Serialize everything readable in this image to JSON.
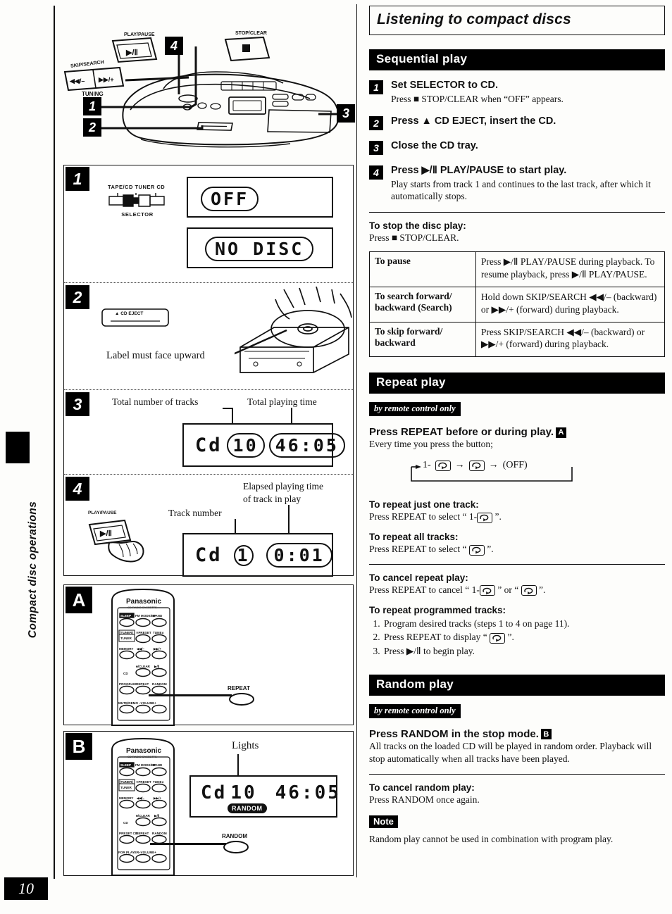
{
  "page": {
    "number": "10",
    "side_tab": "Compact disc operations"
  },
  "header": {
    "title": "Listening to compact discs"
  },
  "sections": {
    "sequential": {
      "heading": "Sequential play",
      "steps": [
        {
          "num": "1",
          "title": "Set SELECTOR to CD.",
          "detail": "Press ■ STOP/CLEAR when “OFF” appears."
        },
        {
          "num": "2",
          "title": "Press ▲ CD EJECT, insert the CD.",
          "detail": ""
        },
        {
          "num": "3",
          "title": "Close the CD tray.",
          "detail": ""
        },
        {
          "num": "4",
          "title": "Press ▶/Ⅱ PLAY/PAUSE to start play.",
          "detail": "Play starts from track 1 and continues to the last track, after which it automatically stops."
        }
      ],
      "stop_heading": "To stop the disc play:",
      "stop_text": "Press ■ STOP/CLEAR.",
      "table": {
        "rows": [
          {
            "left": "To pause",
            "right": "Press ▶/Ⅱ PLAY/PAUSE during playback. To resume playback, press ▶/Ⅱ PLAY/PAUSE."
          },
          {
            "left": "To search forward/ backward (Search)",
            "right": "Hold down SKIP/SEARCH ◀◀/– (backward) or ▶▶/+ (forward) during playback."
          },
          {
            "left": "To skip forward/ backward",
            "right": "Press SKIP/SEARCH ◀◀/– (backward) or ▶▶/+ (forward) during playback."
          }
        ]
      }
    },
    "repeat": {
      "heading": "Repeat play",
      "remote_only": "by remote control only",
      "lead": "Press REPEAT before or during play.",
      "lead_badge": "A",
      "lead_sub": "Every time you press the button;",
      "cycle": {
        "first": "1-",
        "off": "(OFF)"
      },
      "blocks": [
        {
          "h": "To repeat just one track:",
          "p_pre": "Press REPEAT to select “ 1-",
          "p_post": " ”."
        },
        {
          "h": "To repeat all tracks:",
          "p_pre": "Press REPEAT to select “ ",
          "p_post": " ”."
        }
      ],
      "cancel": {
        "h": "To cancel repeat play:",
        "p_pre": "Press REPEAT to cancel “ 1-",
        "p_mid": " ” or “ ",
        "p_post": " ”."
      },
      "programmed": {
        "h": "To repeat programmed tracks:",
        "items": [
          "Program desired tracks (steps 1 to 4 on page 11).",
          "Press REPEAT to display “ ",
          "Press ▶/Ⅱ to begin play."
        ],
        "item2_post": " ”."
      }
    },
    "random": {
      "heading": "Random play",
      "remote_only": "by remote control only",
      "lead": "Press RANDOM in the stop mode.",
      "lead_badge": "B",
      "lead_sub": "All tracks on the loaded CD will be played in random order. Playback will stop automatically when all tracks have been played.",
      "cancel": {
        "h": "To cancel random play:",
        "p": "Press RANDOM once again."
      },
      "note_tag": "Note",
      "note_text": "Random play cannot be used in combination with program play."
    }
  },
  "illustrations": {
    "hero": {
      "labels": {
        "play_pause": "PLAY/PAUSE",
        "stop_clear": "STOP/CLEAR",
        "skip_search": "SKIP/SEARCH",
        "tuning": "TUNING",
        "skip_back": "◀◀/–",
        "skip_fwd": "▶▶/+"
      },
      "callouts": [
        "4",
        "3",
        "1",
        "2"
      ]
    },
    "step1": {
      "badge": "1",
      "selector_labels": "TAPE/CD  TUNER  CD",
      "selector_name": "SELECTOR",
      "display_1": "OFF",
      "display_2": "NO DISC"
    },
    "step2": {
      "badge": "2",
      "eject_button": "▲ CD EJECT",
      "caption": "Label must face upward"
    },
    "step3": {
      "badge": "3",
      "label_tracks": "Total number of tracks",
      "label_time": "Total playing time",
      "display_prefix": "Cd",
      "display_tracks": "10",
      "display_time": "46:05"
    },
    "step4": {
      "badge": "4",
      "button_label": "PLAY/PAUSE",
      "button_glyph": "▶/Ⅱ",
      "label_track": "Track number",
      "label_elapsed_1": "Elapsed playing time",
      "label_elapsed_2": "of track in play",
      "display_prefix": "Cd",
      "display_track": "1",
      "display_time": "0:01"
    },
    "panelA": {
      "badge": "A",
      "brand": "Panasonic",
      "brand_sub": "CD RADIO CASSETTE",
      "callout": "REPEAT",
      "buttons": [
        "SLEEP",
        "FM MODE/BP",
        "BAND",
        "(TUNER)",
        "∨PRESET",
        "TUNE∧",
        "TUNER",
        "MEMORY",
        "◀◀/–",
        "▶▶/+",
        "CD",
        "■/CLEAR",
        "▶/Ⅱ",
        "PROGRAM",
        "REPEAT",
        "RANDOM",
        "MUTE/DEMO",
        "–VOLUME+"
      ]
    },
    "panelB": {
      "badge": "B",
      "brand": "Panasonic",
      "brand_sub": "CD RADIO CASSETTE",
      "callout": "RANDOM",
      "lights_label": "Lights",
      "display_prefix": "Cd",
      "display_tracks": "10",
      "display_time": "46:05",
      "indicator": "RANDOM"
    }
  }
}
